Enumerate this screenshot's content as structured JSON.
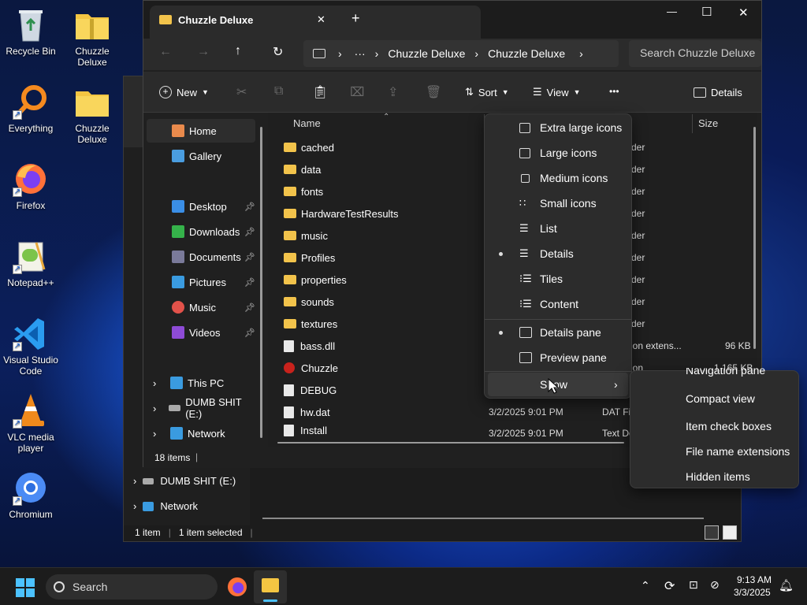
{
  "desktop_icons": [
    {
      "label": "Recycle Bin"
    },
    {
      "label": "Chuzzle Deluxe"
    },
    {
      "label": "Everything"
    },
    {
      "label": "Chuzzle Deluxe"
    },
    {
      "label": "Firefox"
    },
    {
      "label": "Notepad++"
    },
    {
      "label": "Visual Studio Code"
    },
    {
      "label": "VLC media player"
    },
    {
      "label": "Chromium"
    }
  ],
  "window": {
    "tab_title": "Chuzzle Deluxe",
    "tab_close": "✕",
    "new_tab": "+",
    "controls": {
      "minimize": "—",
      "maximize": "☐",
      "close": "✕"
    },
    "address": {
      "more": "···",
      "crumbs": [
        "Chuzzle Deluxe",
        "Chuzzle Deluxe"
      ],
      "search_placeholder": "Search Chuzzle Deluxe"
    },
    "toolbar": {
      "new": "New",
      "sort": "Sort",
      "view": "View",
      "more": "•••",
      "details": "Details"
    },
    "nav": {
      "home": "Home",
      "gallery": "Gallery",
      "quick": [
        {
          "label": "Desktop",
          "color": "#3a8ee6"
        },
        {
          "label": "Downloads",
          "color": "#35b24a"
        },
        {
          "label": "Documents",
          "color": "#7a7a9a"
        },
        {
          "label": "Pictures",
          "color": "#3a9be0"
        },
        {
          "label": "Music",
          "color": "#e2524a"
        },
        {
          "label": "Videos",
          "color": "#8e4bd6"
        }
      ],
      "this_pc": "This PC",
      "drive": "DUMB SHIT (E:)",
      "network": "Network"
    },
    "columns": {
      "name": "Name",
      "size": "Size"
    },
    "files": [
      {
        "name": "cached",
        "type": "folder",
        "type_text": "der"
      },
      {
        "name": "data",
        "type": "folder",
        "type_text": "der"
      },
      {
        "name": "fonts",
        "type": "folder",
        "type_text": "der"
      },
      {
        "name": "HardwareTestResults",
        "type": "folder",
        "type_text": "der"
      },
      {
        "name": "music",
        "type": "folder",
        "type_text": "der"
      },
      {
        "name": "Profiles",
        "type": "folder",
        "type_text": "der"
      },
      {
        "name": "properties",
        "type": "folder",
        "type_text": "der"
      },
      {
        "name": "sounds",
        "type": "folder",
        "type_text": "der"
      },
      {
        "name": "textures",
        "type": "folder",
        "type_text": "der"
      },
      {
        "name": "bass.dll",
        "type": "file",
        "type_text": "ation extens...",
        "size": "96 KB"
      },
      {
        "name": "Chuzzle",
        "type": "app",
        "type_text": "ation",
        "size": "1,165 KB"
      },
      {
        "name": "DEBUG",
        "type": "file"
      },
      {
        "name": "hw.dat",
        "type": "file",
        "date": "3/2/2025 9:01 PM",
        "type_text": "DAT Fi"
      },
      {
        "name": "Install",
        "type": "file",
        "date": "3/2/2025 9:01 PM",
        "type_text": "Text Do"
      }
    ],
    "status": {
      "count": "18 items"
    }
  },
  "back_window": {
    "drive": "DUMB SHIT (E:)",
    "network": "Network",
    "status": {
      "count": "1 item",
      "selected": "1 item selected"
    }
  },
  "view_menu": {
    "items": [
      {
        "label": "Extra large icons"
      },
      {
        "label": "Large icons"
      },
      {
        "label": "Medium icons"
      },
      {
        "label": "Small icons"
      },
      {
        "label": "List"
      },
      {
        "label": "Details",
        "selected": true
      },
      {
        "label": "Tiles"
      },
      {
        "label": "Content"
      }
    ],
    "panes": [
      {
        "label": "Details pane",
        "selected": true
      },
      {
        "label": "Preview pane"
      }
    ],
    "show": "Show"
  },
  "show_menu": {
    "items": [
      "Navigation pane",
      "Compact view",
      "Item check boxes",
      "File name extensions",
      "Hidden items"
    ]
  },
  "taskbar": {
    "search": "Search",
    "time": "9:13 AM",
    "date": "3/3/2025"
  }
}
